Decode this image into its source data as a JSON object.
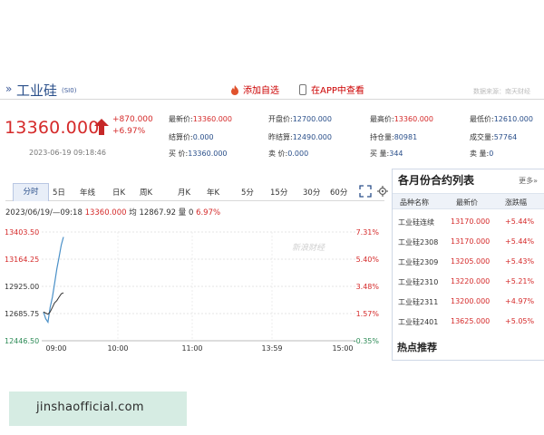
{
  "header": {
    "arrow": "»",
    "name": "工业硅",
    "code": "(SI0)",
    "add_favorite": "添加自选",
    "view_in_app": "在APP中查看",
    "source": "数据来源：南天财经"
  },
  "quote": {
    "price": "13360.000",
    "change": "+870.000",
    "change_pct": "+6.97%",
    "datetime": "2023-06-19 09:18:46",
    "fields": [
      {
        "label": "最新价:",
        "value": "13360.000",
        "color": "red"
      },
      {
        "label": "开盘价:",
        "value": "12700.000",
        "color": "blue"
      },
      {
        "label": "最高价:",
        "value": "13360.000",
        "color": "red"
      },
      {
        "label": "最低价:",
        "value": "12610.000",
        "color": "blue"
      },
      {
        "label": "结算价:",
        "value": "0.000",
        "color": "blue"
      },
      {
        "label": "昨结算:",
        "value": "12490.000",
        "color": "blue"
      },
      {
        "label": "持仓量:",
        "value": "80981",
        "color": "blue"
      },
      {
        "label": "成交量:",
        "value": "57764",
        "color": "blue"
      },
      {
        "label": "买  价:",
        "value": "13360.000",
        "color": "blue"
      },
      {
        "label": "卖  价:",
        "value": "0.000",
        "color": "blue"
      },
      {
        "label": "买  量:",
        "value": "344",
        "color": "blue"
      },
      {
        "label": "卖  量:",
        "value": "0",
        "color": "blue"
      }
    ]
  },
  "tabs": [
    "分时",
    "5日",
    "年线",
    "日K",
    "周K",
    "月K",
    "年K",
    "5分",
    "15分",
    "30分",
    "60分"
  ],
  "info_line": {
    "range": "2023/06/19/—09:18",
    "price": "13360.000",
    "avg_label": "均",
    "avg": "12867.92",
    "vol_label": "量",
    "vol": "0",
    "pct": "6.97%"
  },
  "chart_data": {
    "type": "line",
    "y_left_ticks": [
      "13403.50",
      "13164.25",
      "12925.00",
      "12685.75",
      "12446.50"
    ],
    "y_right_ticks": [
      "7.31%",
      "5.40%",
      "3.48%",
      "1.57%",
      "-0.35%"
    ],
    "x_ticks": [
      "09:00",
      "10:00",
      "11:00",
      "13:59",
      "15:00"
    ],
    "ylim": [
      12446.5,
      13403.5
    ],
    "watermark": "新浪财经",
    "series": [
      {
        "x": [
          "09:00",
          "09:02",
          "09:04",
          "09:06",
          "09:08",
          "09:10",
          "09:12",
          "09:14",
          "09:16",
          "09:18"
        ],
        "values": [
          12700,
          12640,
          12610,
          12740,
          12830,
          12950,
          13080,
          13180,
          13290,
          13360
        ]
      },
      {
        "x": [
          "09:00",
          "09:02",
          "09:04",
          "09:06",
          "09:08",
          "09:10",
          "09:12",
          "09:14",
          "09:16",
          "09:18"
        ],
        "values": [
          12700,
          12690,
          12680,
          12700,
          12740,
          12780,
          12800,
          12830,
          12860,
          12868
        ]
      }
    ]
  },
  "panel": {
    "title": "各月份合约列表",
    "more": "更多»",
    "headers": [
      "品种名称",
      "最新价",
      "涨跌幅"
    ],
    "rows": [
      {
        "name": "工业硅连续",
        "price": "13170.000",
        "pct": "+5.44%"
      },
      {
        "name": "工业硅2308",
        "price": "13170.000",
        "pct": "+5.44%"
      },
      {
        "name": "工业硅2309",
        "price": "13205.000",
        "pct": "+5.43%"
      },
      {
        "name": "工业硅2310",
        "price": "13220.000",
        "pct": "+5.21%"
      },
      {
        "name": "工业硅2311",
        "price": "13200.000",
        "pct": "+4.97%"
      },
      {
        "name": "工业硅2401",
        "price": "13625.000",
        "pct": "+5.05%"
      }
    ],
    "hot": "热点推荐"
  },
  "watermark": "jinshaofficial.com",
  "colors": {
    "up": "#d52a2a",
    "blue": "#2a4f8a",
    "line": "#4a90c8",
    "avg": "#333333"
  }
}
